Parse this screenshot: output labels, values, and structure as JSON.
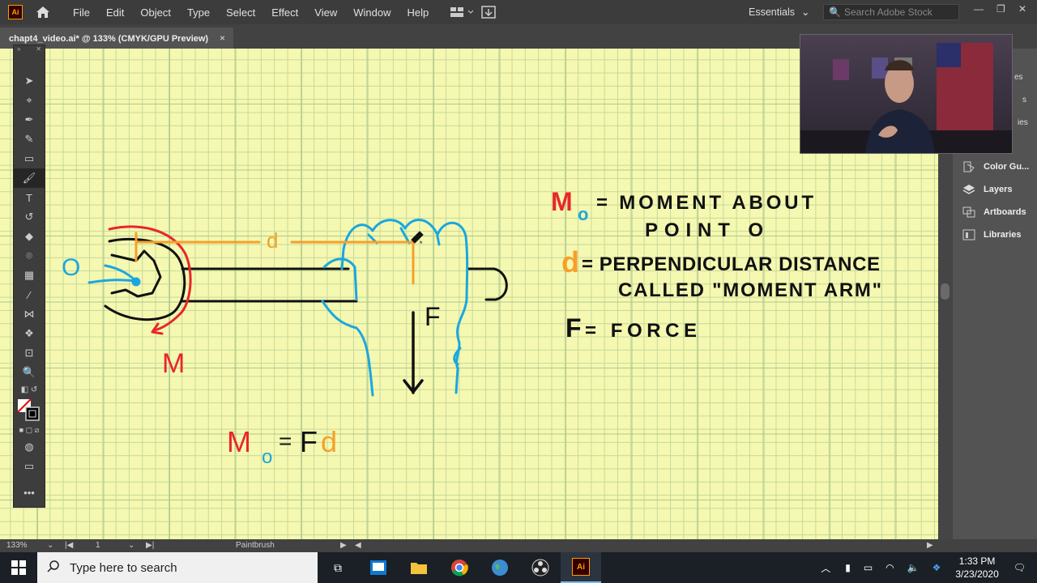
{
  "app": {
    "logo": "Ai",
    "menu": [
      "File",
      "Edit",
      "Object",
      "Type",
      "Select",
      "Effect",
      "View",
      "Window",
      "Help"
    ],
    "workspace": "Essentials",
    "search_placeholder": "Search Adobe Stock"
  },
  "document": {
    "tab_title": "chapt4_video.ai* @ 133% (CMYK/GPU Preview)",
    "close": "×"
  },
  "drawing": {
    "o_label": "O",
    "d_label": "d",
    "f_label": "F",
    "m_label": "M",
    "eq_m": "M",
    "eq_o": "o",
    "eq_eq": "=",
    "eq_f": "F",
    "eq_d": "d",
    "def1_sym_m": "M",
    "def1_sym_o": "o",
    "def1_text_a": "= MOMENT ABOUT",
    "def1_text_b": "POINT O",
    "def2_sym": "d",
    "def2_text_a": "= PERPENDICULAR DISTANCE",
    "def2_text_b": "CALLED \"MOMENT ARM\"",
    "def3_sym": "F",
    "def3_text": "= FORCE"
  },
  "colors": {
    "red": "#e8262b",
    "orange": "#f5a02a",
    "blue": "#1aa7e0",
    "black": "#111111",
    "paper": "#f5f8b0"
  },
  "right_panel": {
    "items": [
      {
        "label": "Color Gu...",
        "icon": "color-guide-icon"
      },
      {
        "label": "Layers",
        "icon": "layers-icon"
      },
      {
        "label": "Artboards",
        "icon": "artboards-icon"
      },
      {
        "label": "Libraries",
        "icon": "libraries-icon"
      }
    ],
    "partial_labels": [
      "es",
      "s",
      "ies"
    ]
  },
  "status": {
    "zoom": "133%",
    "artboard": "1",
    "tool": "Paintbrush"
  },
  "taskbar": {
    "search_placeholder": "Type here to search",
    "time": "1:33 PM",
    "date": "3/23/2020"
  }
}
